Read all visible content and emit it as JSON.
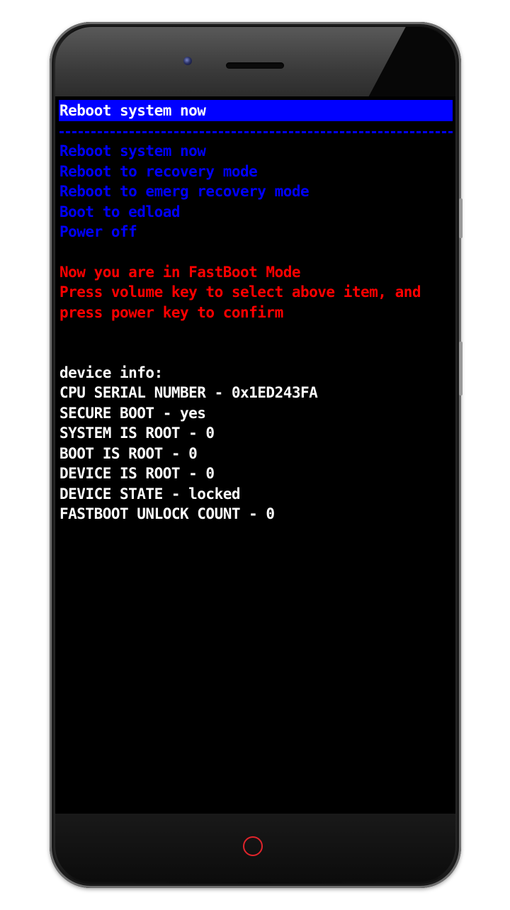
{
  "fastboot": {
    "selected": "Reboot system now",
    "menu": [
      "Reboot system now",
      "Reboot to recovery mode",
      "Reboot to emerg recovery mode",
      "Boot to edload",
      "Power off"
    ],
    "messages": [
      "Now you are in FastBoot Mode",
      "Press volume key to select above item, and",
      "press power key to confirm"
    ],
    "device_info_header": "device info:",
    "device_info": [
      "CPU SERIAL NUMBER - 0x1ED243FA",
      "SECURE BOOT - yes",
      "SYSTEM IS ROOT - 0",
      "BOOT IS ROOT - 0",
      "DEVICE IS ROOT - 0",
      "DEVICE STATE - locked",
      "FASTBOOT UNLOCK COUNT - 0"
    ]
  },
  "colors": {
    "menu": "#0000ff",
    "message": "#ff0000",
    "info": "#ffffff",
    "home_button": "#e0242b"
  }
}
